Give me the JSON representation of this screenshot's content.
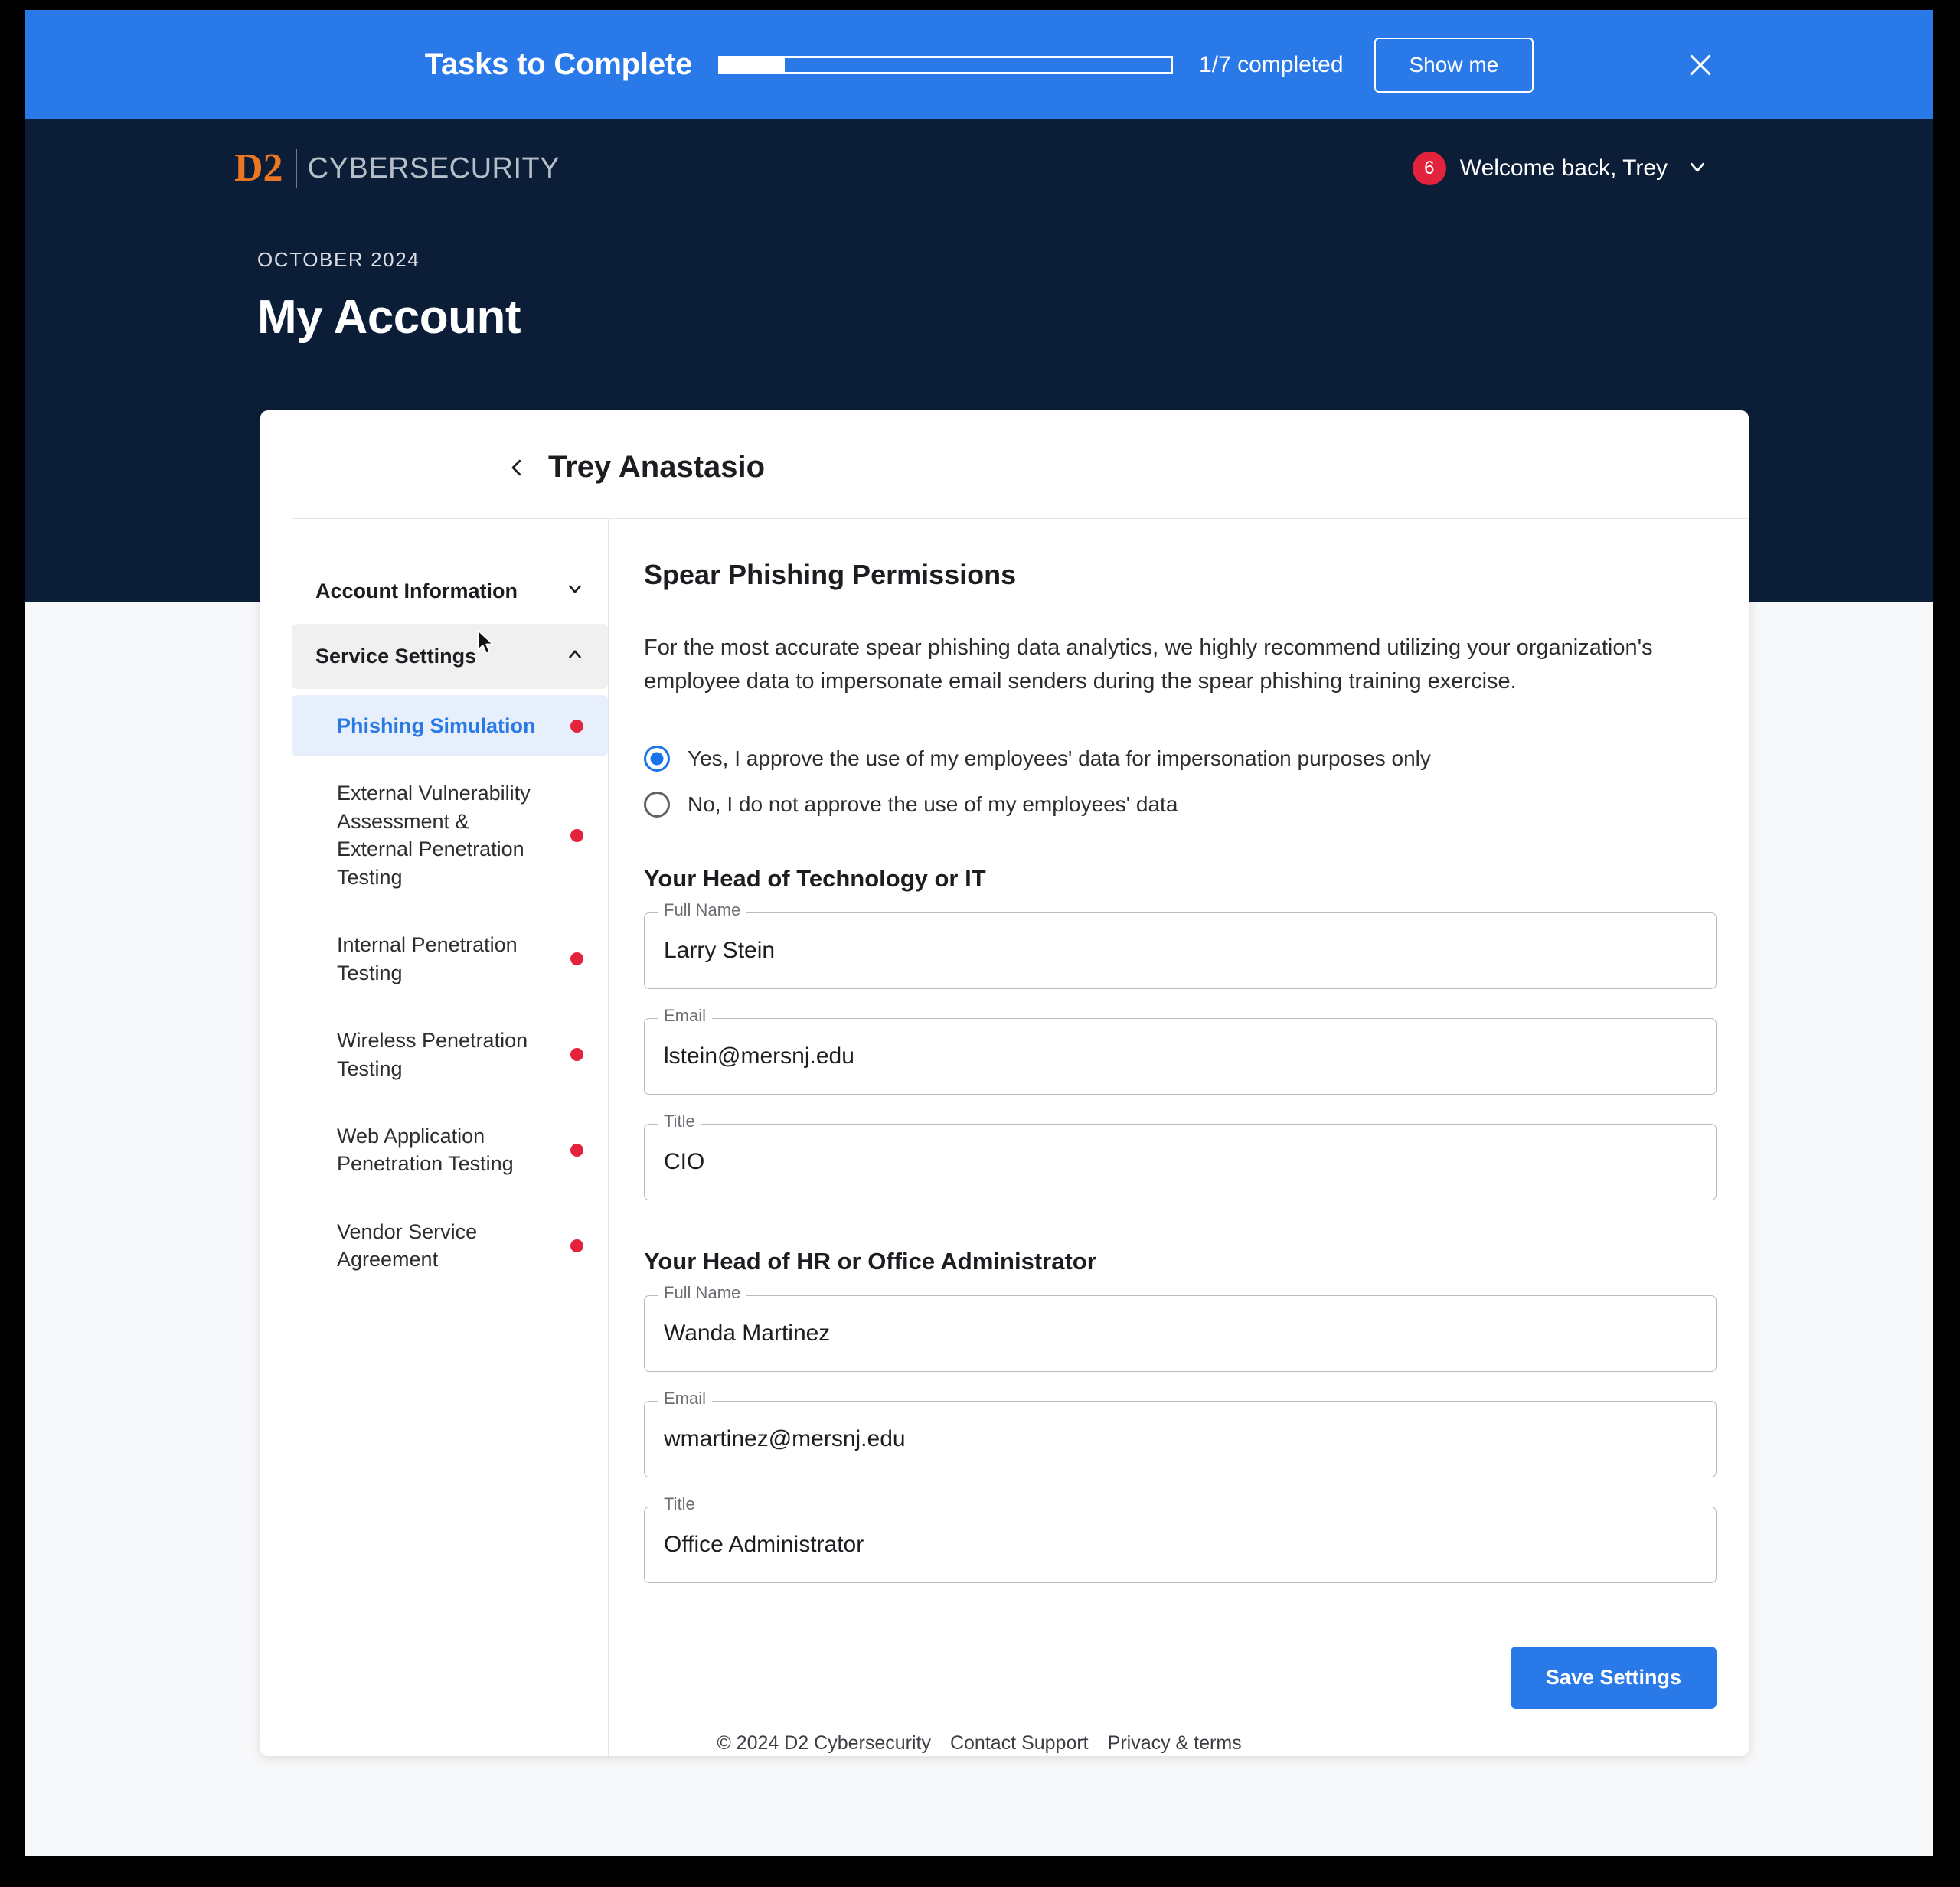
{
  "task_banner": {
    "title": "Tasks to Complete",
    "progress_label": "1/7 completed",
    "progress_completed": 1,
    "progress_total": 7,
    "show_me_label": "Show me",
    "close_icon": "close-icon",
    "accent_color": "#2979e8"
  },
  "brand": {
    "mark": "D2",
    "name": "CYBERSECURITY",
    "mark_color": "#eb7722",
    "name_color": "#b6bec7"
  },
  "user": {
    "badge_count": "6",
    "greeting": "Welcome back, Trey",
    "badge_color": "#e3223c",
    "chevron_icon": "chevron-down-icon"
  },
  "page_head": {
    "month": "OCTOBER 2024",
    "title": "My Account"
  },
  "card": {
    "back_icon": "chevron-left-icon",
    "title": "Trey Anastasio"
  },
  "sidebar": {
    "sections": [
      {
        "label": "Account Information",
        "icon": "chevron-down-icon",
        "expanded": false,
        "active": false
      },
      {
        "label": "Service Settings",
        "icon": "chevron-up-icon",
        "expanded": true,
        "active": true
      }
    ],
    "items": [
      {
        "label": "Phishing Simulation",
        "selected": true,
        "dot": true
      },
      {
        "label": "External Vulnerability Assessment & External Penetration Testing",
        "selected": false,
        "dot": true
      },
      {
        "label": "Internal Penetration Testing",
        "selected": false,
        "dot": true
      },
      {
        "label": "Wireless Penetration Testing",
        "selected": false,
        "dot": true
      },
      {
        "label": "Web Application Penetration Testing",
        "selected": false,
        "dot": true
      },
      {
        "label": "Vendor Service Agreement",
        "selected": false,
        "dot": true
      }
    ],
    "dot_color": "#e3223c"
  },
  "content": {
    "title": "Spear Phishing Permissions",
    "description": "For the most accurate spear phishing data analytics, we highly recommend utilizing your organization's employee data to impersonate email senders during the spear phishing training exercise.",
    "radios": [
      {
        "label": "Yes, I approve the use of my employees' data for impersonation purposes only",
        "checked": true
      },
      {
        "label": "No, I do not approve the use of my employees' data",
        "checked": false
      }
    ],
    "groups": [
      {
        "heading": "Your Head of Technology or IT",
        "fields": [
          {
            "legend": "Full Name",
            "value": "Larry Stein",
            "placeholder": "Full Name"
          },
          {
            "legend": "Email",
            "value": "lstein@mersnj.edu",
            "placeholder": "Email"
          },
          {
            "legend": "Title",
            "value": "CIO",
            "placeholder": "Title"
          }
        ]
      },
      {
        "heading": "Your Head of HR or Office Administrator",
        "fields": [
          {
            "legend": "Full Name",
            "value": "Wanda Martinez",
            "placeholder": "Full Name"
          },
          {
            "legend": "Email",
            "value": "wmartinez@mersnj.edu",
            "placeholder": "Email"
          },
          {
            "legend": "Title",
            "value": "Office Administrator",
            "placeholder": "Title"
          }
        ]
      }
    ],
    "save_label": "Save Settings"
  },
  "footer": {
    "copyright": "© 2024 D2 Cybersecurity",
    "links": [
      "Contact Support",
      "Privacy & terms"
    ]
  }
}
